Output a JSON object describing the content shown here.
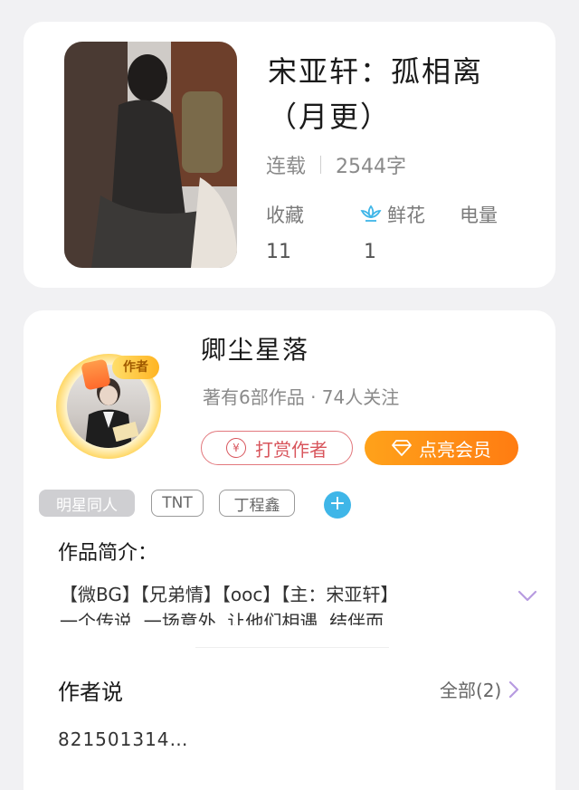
{
  "book": {
    "title": "宋亚轩：孤相离（月更）",
    "status": "连载",
    "word_count": "2544字",
    "stats": {
      "collect_label": "收藏",
      "collect_value": "11",
      "flower_label": "鲜花",
      "flower_value": "1",
      "power_label": "电量"
    }
  },
  "author": {
    "badge": "作者",
    "name": "卿尘星落",
    "meta": "著有6部作品 · 74人关注",
    "tip_label": "打赏作者",
    "tip_icon_glyph": "¥",
    "vip_label": "点亮会员"
  },
  "tags": [
    "明星同人",
    "TNT",
    "丁程鑫"
  ],
  "add_tag_glyph": "+",
  "intro": {
    "title": "作品简介：",
    "line1": "【微BG】【兄弟情】【ooc】【主：宋亚轩】",
    "line2": "一个传说  一场意外  让他们相遇  结伴而…"
  },
  "author_says": {
    "title": "作者说",
    "all_label": "全部(2)",
    "text": "821501314…"
  },
  "colors": {
    "accent_orange": "#ff8a16",
    "tip_red": "#d8555c",
    "add_blue": "#3fb6e8",
    "chevron_purple": "#b79be0"
  }
}
